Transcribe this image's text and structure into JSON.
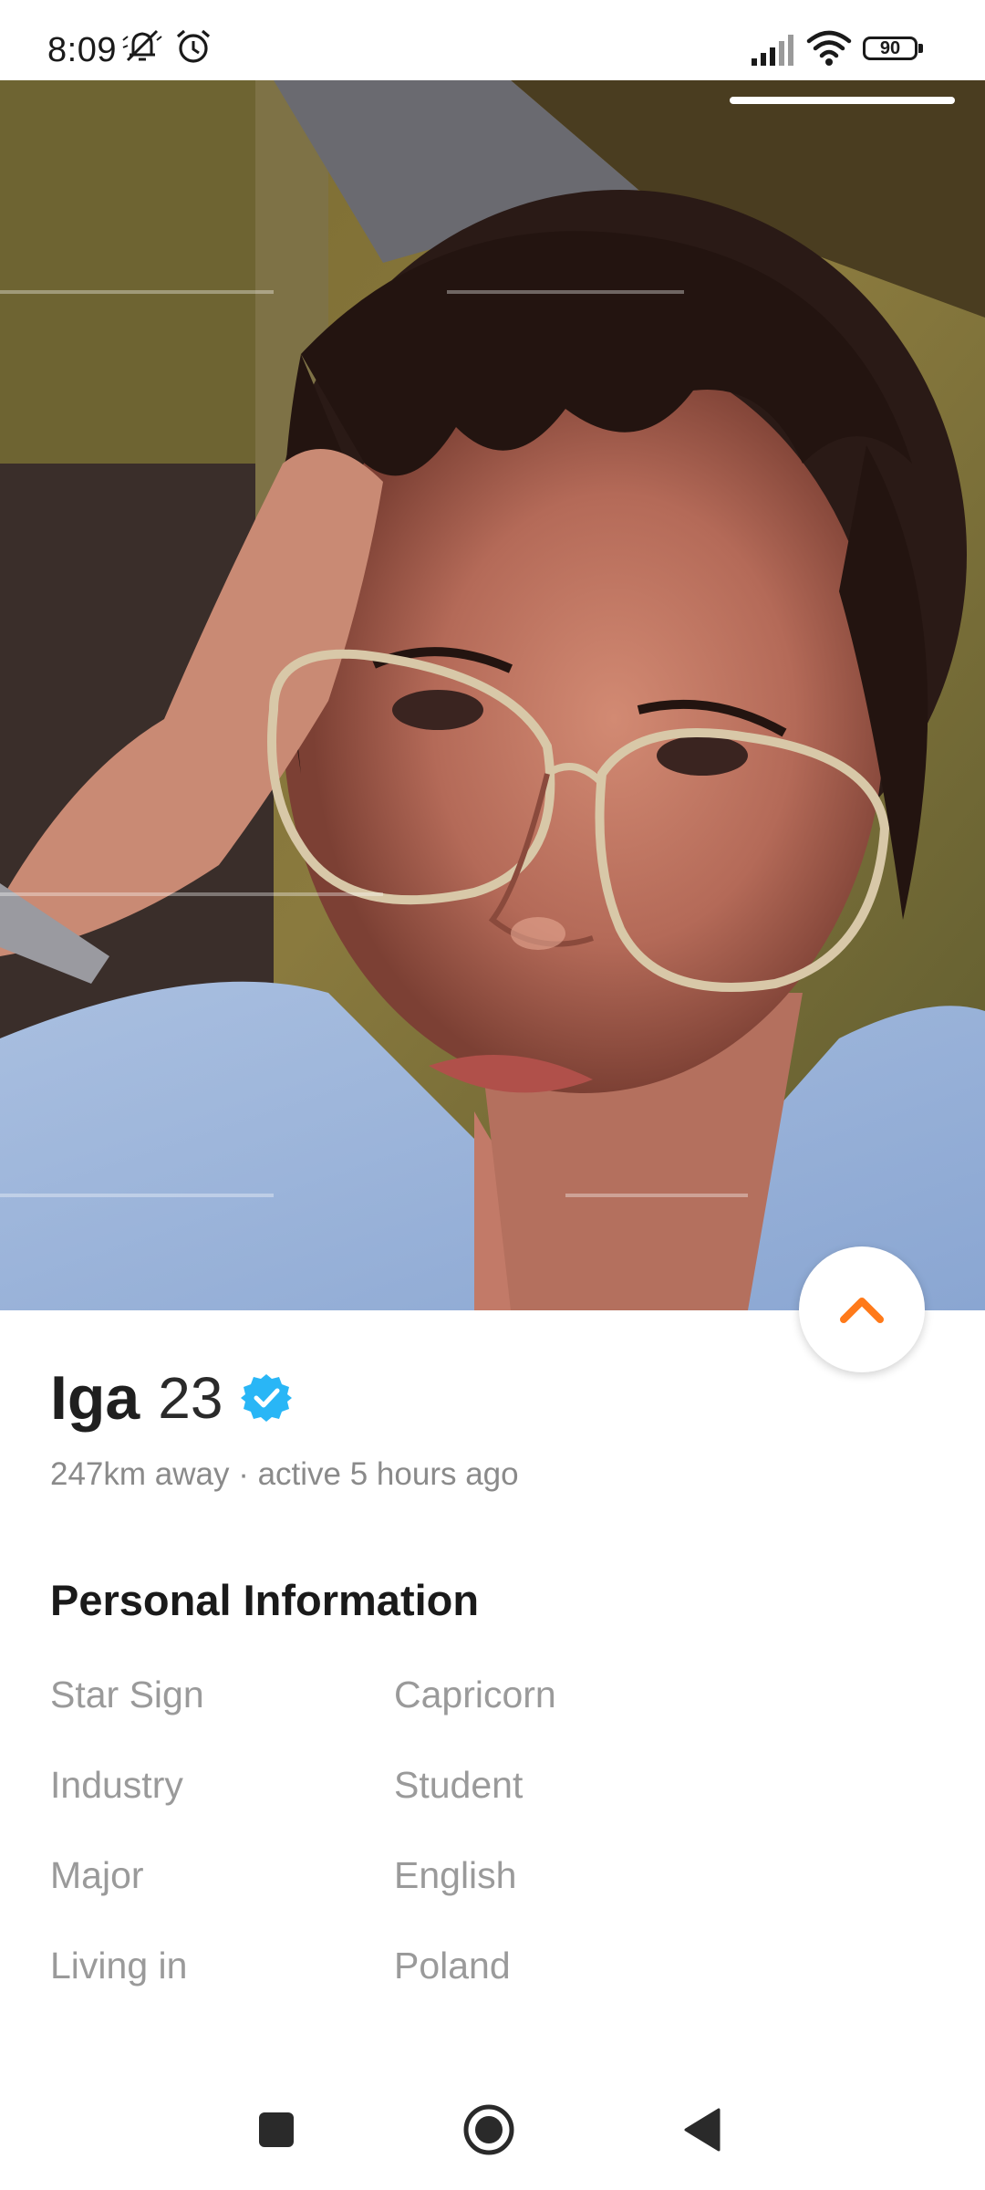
{
  "status_bar": {
    "time": "8:09",
    "battery": "90",
    "icons": [
      "mute-icon",
      "alarm-icon",
      "signal-icon",
      "wifi-icon",
      "battery-icon"
    ]
  },
  "profile": {
    "name": "Iga",
    "age": "23",
    "verified": true,
    "subtitle": "247km away · active 5 hours ago"
  },
  "personal_info": {
    "title": "Personal Information",
    "rows": [
      {
        "label": "Star Sign",
        "value": "Capricorn"
      },
      {
        "label": "Industry",
        "value": "Student"
      },
      {
        "label": "Major",
        "value": "English"
      },
      {
        "label": "Living in",
        "value": "Poland"
      }
    ]
  },
  "colors": {
    "accent": "#FF7A1A",
    "verified": "#29B6F6",
    "text_primary": "#1F1F1F",
    "text_secondary": "#8A8A8A"
  }
}
